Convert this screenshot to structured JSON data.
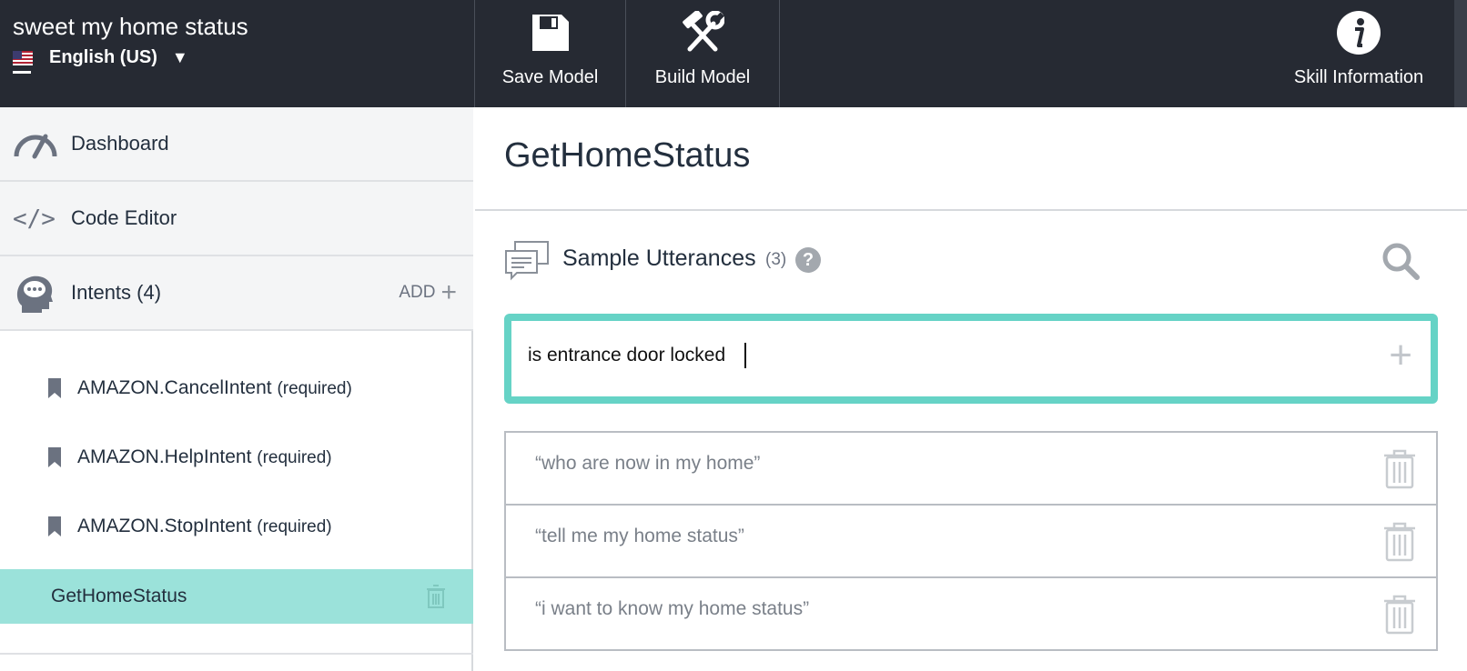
{
  "header": {
    "skill_name": "sweet my home status",
    "locale": "English (US)",
    "buttons": {
      "save": "Save Model",
      "build": "Build Model",
      "info": "Skill Information"
    }
  },
  "sidebar": {
    "dashboard": "Dashboard",
    "code_editor": "Code Editor",
    "intents_label": "Intents (4)",
    "add_label": "ADD",
    "intents": [
      {
        "name": "AMAZON.CancelIntent",
        "note": "(required)"
      },
      {
        "name": "AMAZON.HelpIntent",
        "note": "(required)"
      },
      {
        "name": "AMAZON.StopIntent",
        "note": "(required)"
      },
      {
        "name": "GetHomeStatus",
        "note": ""
      }
    ],
    "selected_intent": "GetHomeStatus"
  },
  "main": {
    "title": "GetHomeStatus",
    "sample_utterances": {
      "title": "Sample Utterances",
      "count": "(3)",
      "input_value": "is entrance door locked",
      "items": [
        "“who are now in my home”",
        "“tell me my home status”",
        "“i want to know my home status”"
      ]
    }
  },
  "colors": {
    "topbar": "#262a33",
    "accent": "#66d3c6",
    "selected_row": "#9be2da"
  },
  "icons": {
    "save": "floppy-disk-icon",
    "build": "hammer-wrench-icon",
    "info": "info-icon",
    "dashboard": "gauge-icon",
    "code_editor": "code-brackets-icon",
    "intents": "head-chat-icon",
    "intent_item": "bookmark-icon",
    "delete": "trash-icon",
    "sample_utterances": "speech-bubbles-icon",
    "help": "question-icon",
    "search": "search-icon",
    "add": "plus-icon"
  }
}
